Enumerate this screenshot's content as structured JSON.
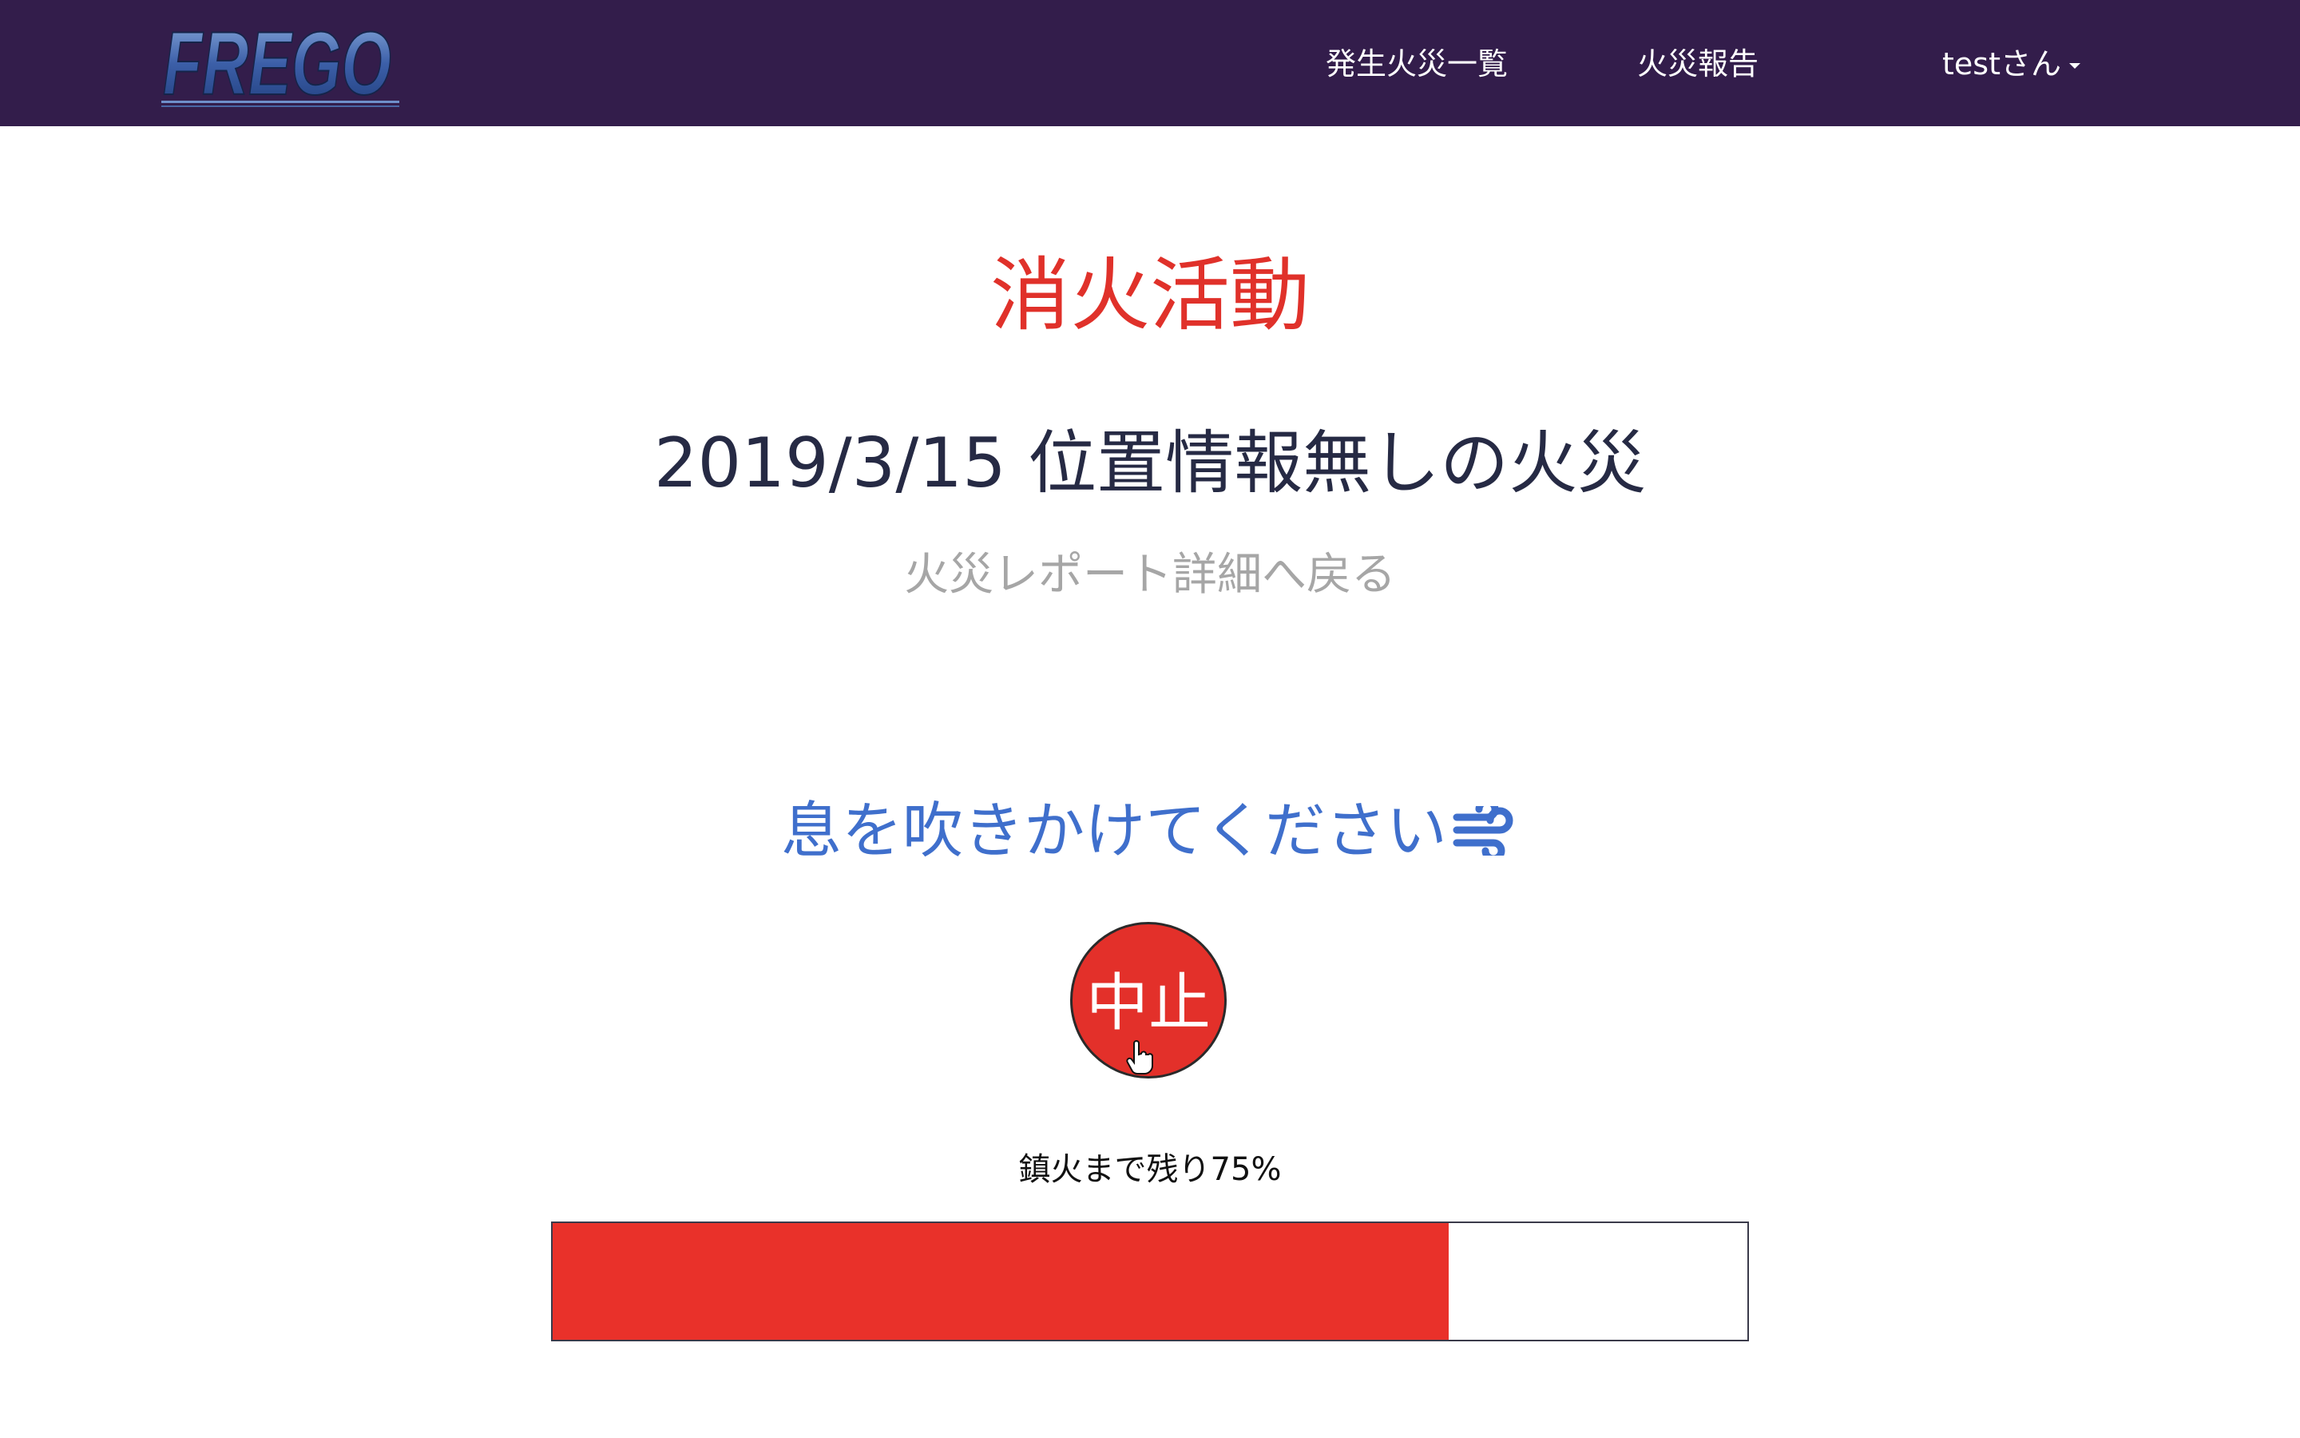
{
  "navbar": {
    "logo_text": "FREGO",
    "links": [
      {
        "label": "発生火災一覧"
      },
      {
        "label": "火災報告"
      }
    ],
    "user_label": "testさん",
    "background": "#331d4b"
  },
  "main": {
    "title": "消火活動",
    "fire_name": "2019/3/15 位置情報無しの火災",
    "back_link": "火災レポート詳細へ戻る",
    "instruction": "息を吹きかけてください",
    "instruction_icon": "wind-icon",
    "stop_button": "中止",
    "status_text": "鎮火まで残り75%",
    "progress_percent": 75
  },
  "colors": {
    "title_red": "#e0312a",
    "instruction_blue": "#3f6fcc",
    "progress_fill": "#e9312a",
    "button_red": "#e3302a"
  }
}
